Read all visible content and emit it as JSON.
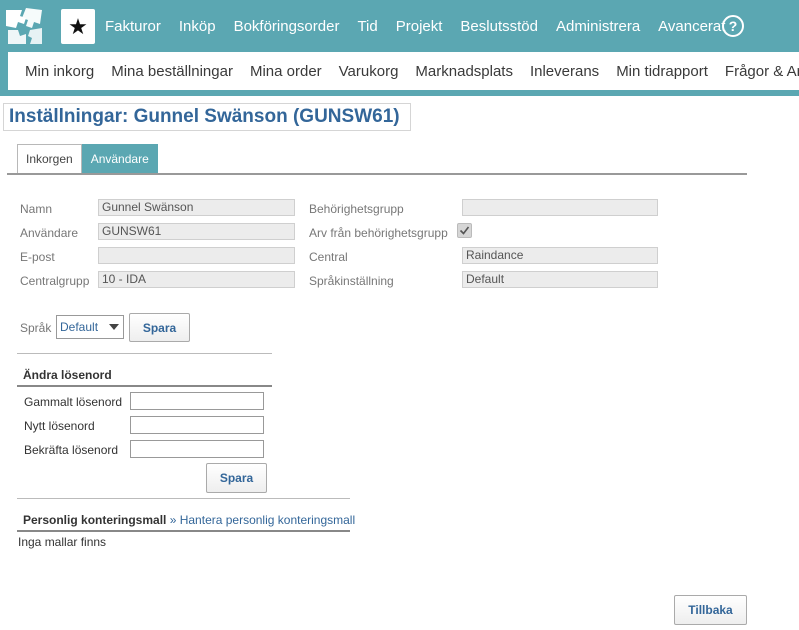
{
  "topbar": {
    "logo_icon": "puzzle-logo-icon",
    "star_icon": "star-icon",
    "star_glyph": "★",
    "nav_items": [
      "Fakturor",
      "Inköp",
      "Bokföringsorder",
      "Tid",
      "Projekt",
      "Beslutsstöd",
      "Administrera",
      "Avancerat"
    ],
    "help_glyph": "?",
    "help_icon": "help-icon"
  },
  "subnav": {
    "items": [
      "Min inkorg",
      "Mina beställningar",
      "Mina order",
      "Varukorg",
      "Marknadsplats",
      "Inleverans",
      "Min tidrapport",
      "Frågor & Analys"
    ]
  },
  "page": {
    "title": "Inställningar: Gunnel Swänson (GUNSW61)"
  },
  "tabs": [
    {
      "label": "Inkorgen",
      "active": false
    },
    {
      "label": "Användare",
      "active": true
    }
  ],
  "user_fields": {
    "name_label": "Namn",
    "name_value": "Gunnel Swänson",
    "user_label": "Användare",
    "user_value": "GUNSW61",
    "email_label": "E-post",
    "email_value": "",
    "centralgroup_label": "Centralgrupp",
    "centralgroup_value": "10 - IDA",
    "permgroup_label": "Behörighetsgrupp",
    "permgroup_value": "",
    "inherit_label": "Arv från behörighetsgrupp",
    "inherit_checked": true,
    "central_label": "Central",
    "central_value": "Raindance",
    "langsetting_label": "Språkinställning",
    "langsetting_value": "Default"
  },
  "language": {
    "label": "Språk",
    "selected": "Default",
    "save_label": "Spara"
  },
  "password": {
    "title": "Ändra lösenord",
    "old_label": "Gammalt lösenord",
    "new_label": "Nytt lösenord",
    "confirm_label": "Bekräfta lösenord",
    "save_label": "Spara"
  },
  "templates": {
    "title": "Personlig konteringsmall",
    "separator": " » ",
    "link_label": "Hantera personlig konteringsmall",
    "empty_text": "Inga mallar finns"
  },
  "footer": {
    "back_label": "Tillbaka"
  },
  "colors": {
    "accent": "#5ba7b2",
    "link": "#336699"
  }
}
